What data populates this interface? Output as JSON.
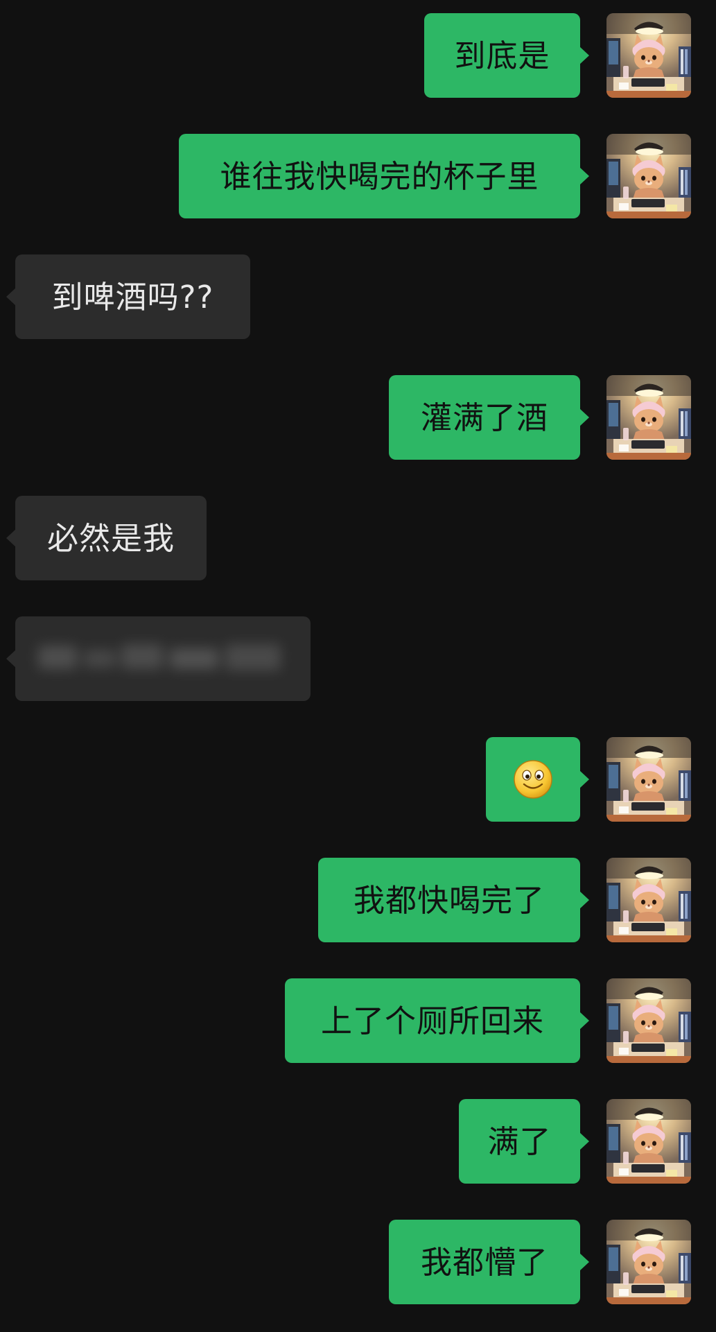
{
  "conversation": {
    "messages": [
      {
        "side": "out",
        "text": "到底是"
      },
      {
        "side": "out",
        "text": "谁往我快喝完的杯子里"
      },
      {
        "side": "in",
        "text": "到啤酒吗??"
      },
      {
        "side": "out",
        "text": "灌满了酒"
      },
      {
        "side": "in",
        "text": "必然是我"
      },
      {
        "side": "in",
        "text": "",
        "blurred": true
      },
      {
        "side": "out",
        "emoji": "smile-emoji"
      },
      {
        "side": "out",
        "text": "我都快喝完了"
      },
      {
        "side": "out",
        "text": "上了个厕所回来"
      },
      {
        "side": "out",
        "text": "满了"
      },
      {
        "side": "out",
        "text": "我都懵了"
      }
    ]
  },
  "theme": {
    "background": "#111111",
    "outgoing_bubble": "#2db765",
    "incoming_bubble": "#2c2c2c",
    "outgoing_text": "#111111",
    "incoming_text": "#e9e9e9"
  },
  "avatar": {
    "icon": "cat-at-desk-avatar-icon"
  }
}
